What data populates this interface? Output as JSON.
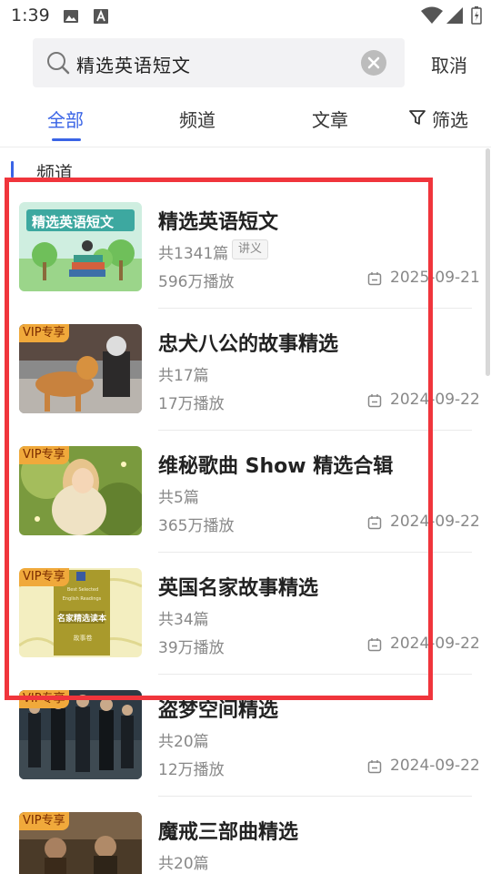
{
  "status_bar": {
    "time": "1:39"
  },
  "search": {
    "query": "精选英语短文",
    "cancel_label": "取消"
  },
  "tabs": [
    {
      "label": "全部",
      "active": true
    },
    {
      "label": "频道",
      "active": false
    },
    {
      "label": "文章",
      "active": false
    }
  ],
  "filter": {
    "label": "筛选"
  },
  "section": {
    "title": "频道"
  },
  "colors": {
    "accent": "#3a64e6",
    "highlight": "#f0353c",
    "vip": "#f0a93b"
  },
  "items": [
    {
      "title": "精选英语短文",
      "count": "共1341篇",
      "tag": "讲义",
      "plays": "596万播放",
      "date": "2025-09-21",
      "vip": "",
      "thumb_text": "精选英语短文"
    },
    {
      "title": "忠犬八公的故事精选",
      "count": "共17篇",
      "tag": "",
      "plays": "17万播放",
      "date": "2024-09-22",
      "vip": "VIP专享"
    },
    {
      "title": "维秘歌曲 Show 精选合辑",
      "count": "共5篇",
      "tag": "",
      "plays": "365万播放",
      "date": "2024-09-22",
      "vip": "VIP专享"
    },
    {
      "title": "英国名家故事精选",
      "count": "共34篇",
      "tag": "",
      "plays": "39万播放",
      "date": "2024-09-22",
      "vip": "VIP专享",
      "thumb_text_en1": "Best Selected",
      "thumb_text_en2": "English Readings",
      "thumb_text_cn": "名家精选读本",
      "thumb_text_sub": "故事卷"
    },
    {
      "title": "盗梦空间精选",
      "count": "共20篇",
      "tag": "",
      "plays": "12万播放",
      "date": "2024-09-22",
      "vip": "VIP专享"
    },
    {
      "title": "魔戒三部曲精选",
      "count": "共20篇",
      "tag": "",
      "plays": "",
      "date": "",
      "vip": "VIP专享"
    }
  ]
}
